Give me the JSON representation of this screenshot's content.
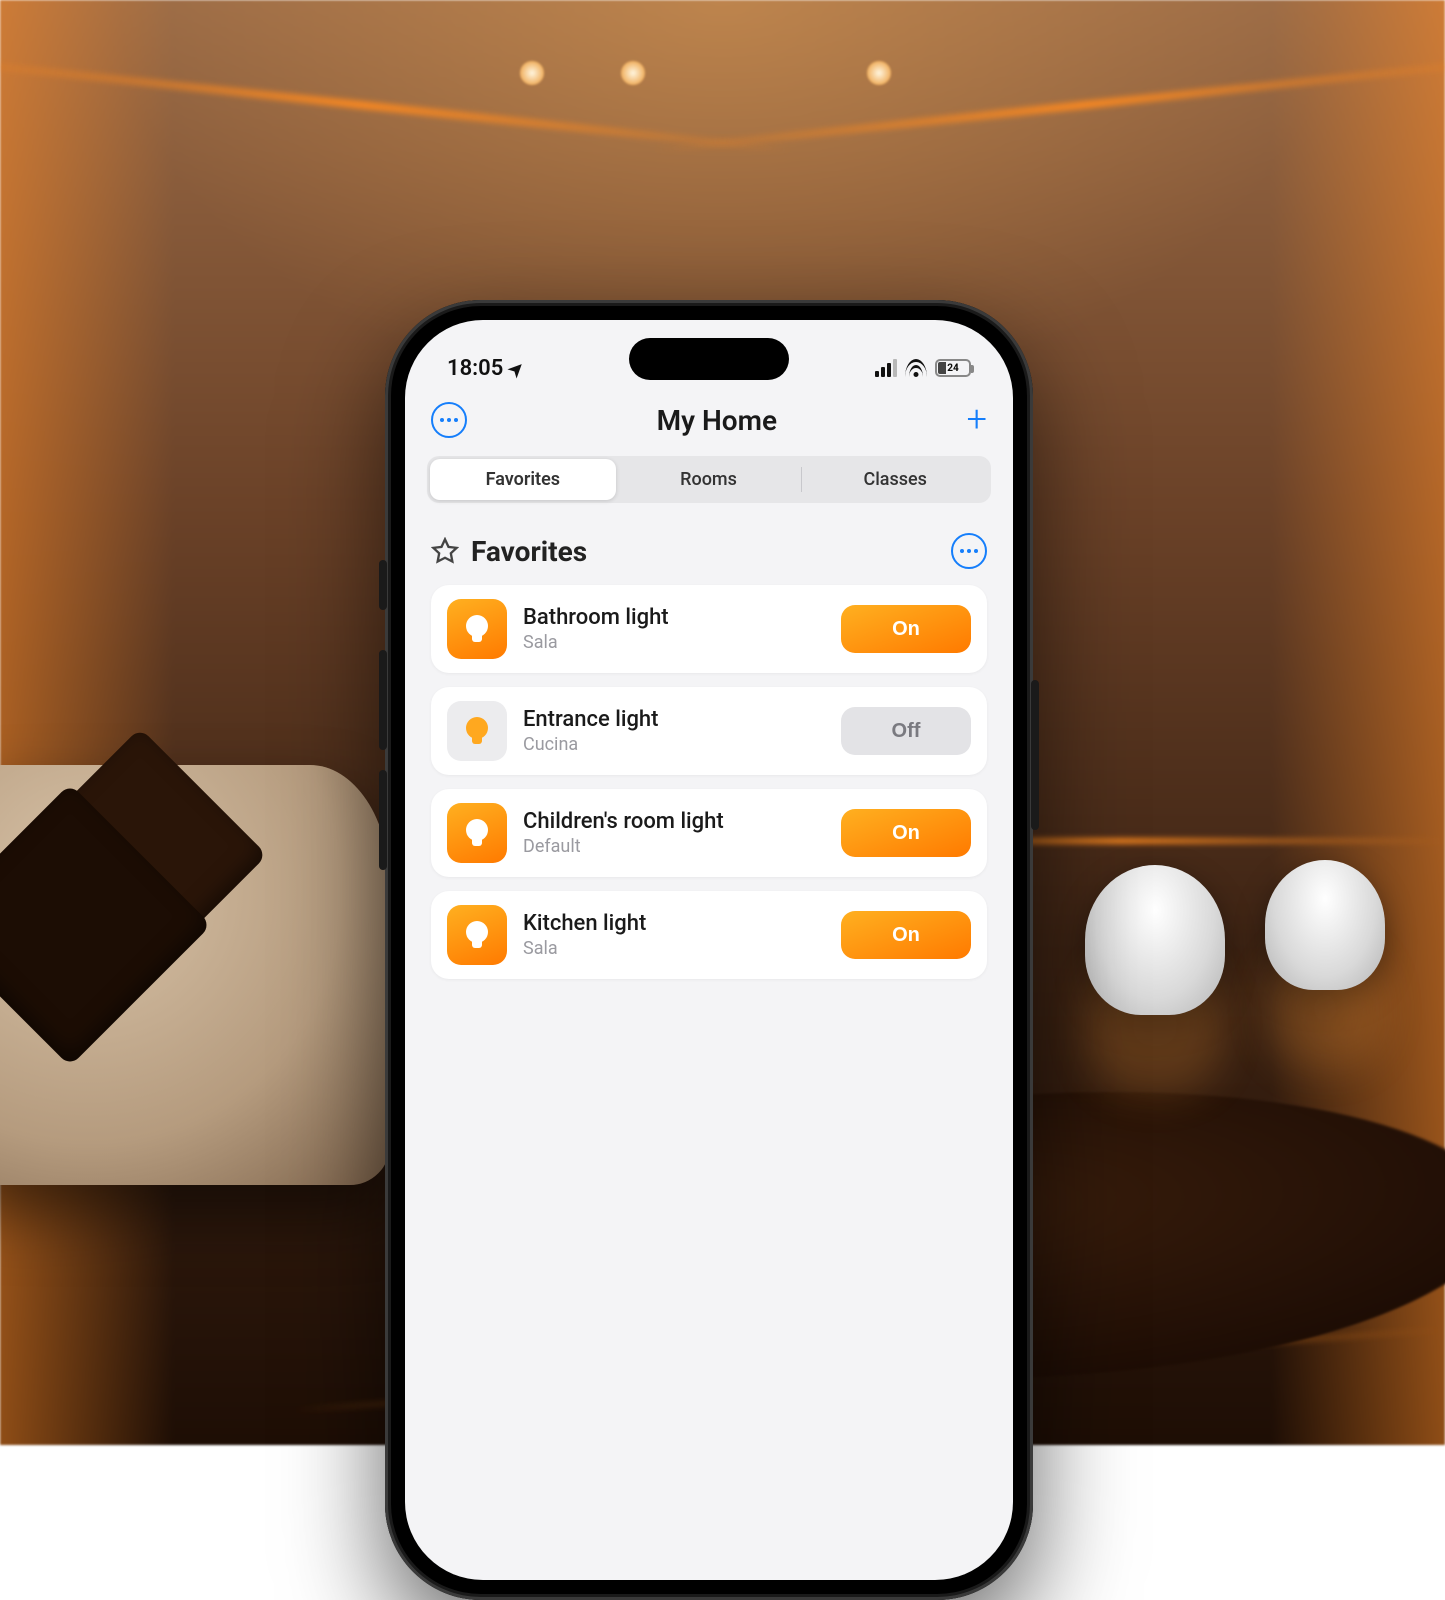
{
  "status_bar": {
    "time": "18:05",
    "battery_level": "24"
  },
  "header": {
    "title": "My Home"
  },
  "tabs": [
    {
      "label": "Favorites",
      "active": true
    },
    {
      "label": "Rooms",
      "active": false
    },
    {
      "label": "Classes",
      "active": false
    }
  ],
  "section": {
    "title": "Favorites"
  },
  "devices": [
    {
      "name": "Bathroom light",
      "room": "Sala",
      "state": "On",
      "on": true
    },
    {
      "name": "Entrance light",
      "room": "Cucina",
      "state": "Off",
      "on": false
    },
    {
      "name": "Children's room light",
      "room": "Default",
      "state": "On",
      "on": true
    },
    {
      "name": "Kitchen light",
      "room": "Sala",
      "state": "On",
      "on": true
    }
  ]
}
